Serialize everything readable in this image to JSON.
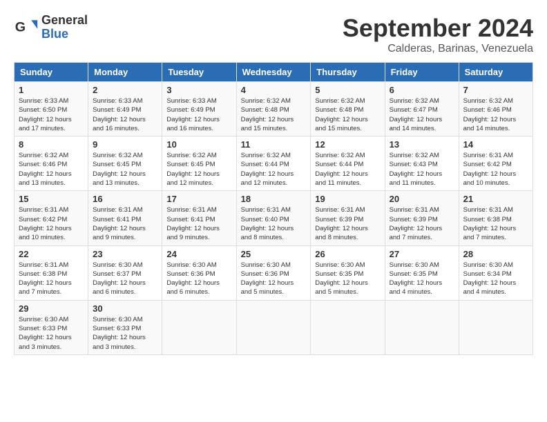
{
  "header": {
    "logo_line1": "General",
    "logo_line2": "Blue",
    "month": "September 2024",
    "location": "Calderas, Barinas, Venezuela"
  },
  "weekdays": [
    "Sunday",
    "Monday",
    "Tuesday",
    "Wednesday",
    "Thursday",
    "Friday",
    "Saturday"
  ],
  "weeks": [
    [
      {
        "day": "1",
        "sunrise": "6:33 AM",
        "sunset": "6:50 PM",
        "daylight": "12 hours and 17 minutes."
      },
      {
        "day": "2",
        "sunrise": "6:33 AM",
        "sunset": "6:49 PM",
        "daylight": "12 hours and 16 minutes."
      },
      {
        "day": "3",
        "sunrise": "6:33 AM",
        "sunset": "6:49 PM",
        "daylight": "12 hours and 16 minutes."
      },
      {
        "day": "4",
        "sunrise": "6:32 AM",
        "sunset": "6:48 PM",
        "daylight": "12 hours and 15 minutes."
      },
      {
        "day": "5",
        "sunrise": "6:32 AM",
        "sunset": "6:48 PM",
        "daylight": "12 hours and 15 minutes."
      },
      {
        "day": "6",
        "sunrise": "6:32 AM",
        "sunset": "6:47 PM",
        "daylight": "12 hours and 14 minutes."
      },
      {
        "day": "7",
        "sunrise": "6:32 AM",
        "sunset": "6:46 PM",
        "daylight": "12 hours and 14 minutes."
      }
    ],
    [
      {
        "day": "8",
        "sunrise": "6:32 AM",
        "sunset": "6:46 PM",
        "daylight": "12 hours and 13 minutes."
      },
      {
        "day": "9",
        "sunrise": "6:32 AM",
        "sunset": "6:45 PM",
        "daylight": "12 hours and 13 minutes."
      },
      {
        "day": "10",
        "sunrise": "6:32 AM",
        "sunset": "6:45 PM",
        "daylight": "12 hours and 12 minutes."
      },
      {
        "day": "11",
        "sunrise": "6:32 AM",
        "sunset": "6:44 PM",
        "daylight": "12 hours and 12 minutes."
      },
      {
        "day": "12",
        "sunrise": "6:32 AM",
        "sunset": "6:44 PM",
        "daylight": "12 hours and 11 minutes."
      },
      {
        "day": "13",
        "sunrise": "6:32 AM",
        "sunset": "6:43 PM",
        "daylight": "12 hours and 11 minutes."
      },
      {
        "day": "14",
        "sunrise": "6:31 AM",
        "sunset": "6:42 PM",
        "daylight": "12 hours and 10 minutes."
      }
    ],
    [
      {
        "day": "15",
        "sunrise": "6:31 AM",
        "sunset": "6:42 PM",
        "daylight": "12 hours and 10 minutes."
      },
      {
        "day": "16",
        "sunrise": "6:31 AM",
        "sunset": "6:41 PM",
        "daylight": "12 hours and 9 minutes."
      },
      {
        "day": "17",
        "sunrise": "6:31 AM",
        "sunset": "6:41 PM",
        "daylight": "12 hours and 9 minutes."
      },
      {
        "day": "18",
        "sunrise": "6:31 AM",
        "sunset": "6:40 PM",
        "daylight": "12 hours and 8 minutes."
      },
      {
        "day": "19",
        "sunrise": "6:31 AM",
        "sunset": "6:39 PM",
        "daylight": "12 hours and 8 minutes."
      },
      {
        "day": "20",
        "sunrise": "6:31 AM",
        "sunset": "6:39 PM",
        "daylight": "12 hours and 7 minutes."
      },
      {
        "day": "21",
        "sunrise": "6:31 AM",
        "sunset": "6:38 PM",
        "daylight": "12 hours and 7 minutes."
      }
    ],
    [
      {
        "day": "22",
        "sunrise": "6:31 AM",
        "sunset": "6:38 PM",
        "daylight": "12 hours and 7 minutes."
      },
      {
        "day": "23",
        "sunrise": "6:30 AM",
        "sunset": "6:37 PM",
        "daylight": "12 hours and 6 minutes."
      },
      {
        "day": "24",
        "sunrise": "6:30 AM",
        "sunset": "6:36 PM",
        "daylight": "12 hours and 6 minutes."
      },
      {
        "day": "25",
        "sunrise": "6:30 AM",
        "sunset": "6:36 PM",
        "daylight": "12 hours and 5 minutes."
      },
      {
        "day": "26",
        "sunrise": "6:30 AM",
        "sunset": "6:35 PM",
        "daylight": "12 hours and 5 minutes."
      },
      {
        "day": "27",
        "sunrise": "6:30 AM",
        "sunset": "6:35 PM",
        "daylight": "12 hours and 4 minutes."
      },
      {
        "day": "28",
        "sunrise": "6:30 AM",
        "sunset": "6:34 PM",
        "daylight": "12 hours and 4 minutes."
      }
    ],
    [
      {
        "day": "29",
        "sunrise": "6:30 AM",
        "sunset": "6:33 PM",
        "daylight": "12 hours and 3 minutes."
      },
      {
        "day": "30",
        "sunrise": "6:30 AM",
        "sunset": "6:33 PM",
        "daylight": "12 hours and 3 minutes."
      },
      null,
      null,
      null,
      null,
      null
    ]
  ]
}
